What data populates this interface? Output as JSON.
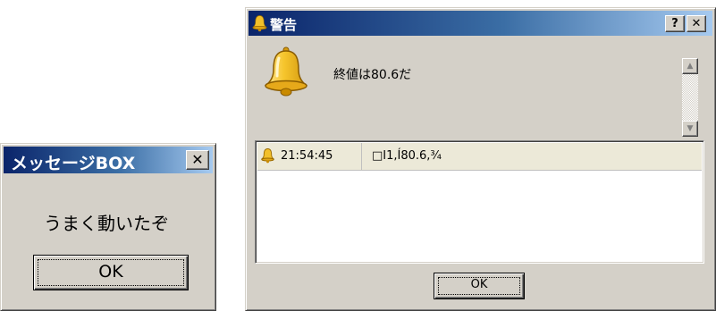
{
  "message_box": {
    "title": "メッセージBOX",
    "close_glyph": "✕",
    "text": "うまく動いたぞ",
    "ok_label": "OK"
  },
  "warning_dialog": {
    "title": "警告",
    "help_label": "?",
    "close_glyph": "✕",
    "message": "終値は80.6だ",
    "icon": "bell-icon",
    "scroll_up_glyph": "▲",
    "scroll_down_glyph": "▼",
    "log": [
      {
        "time": "21:54:45",
        "text": "□I1,Í80.6,¾"
      }
    ],
    "ok_label": "OK"
  },
  "colors": {
    "title_active_start": "#0a246a",
    "title_active_end": "#a6caf0",
    "face": "#d4d0c8",
    "bell": "#f2c02a"
  }
}
